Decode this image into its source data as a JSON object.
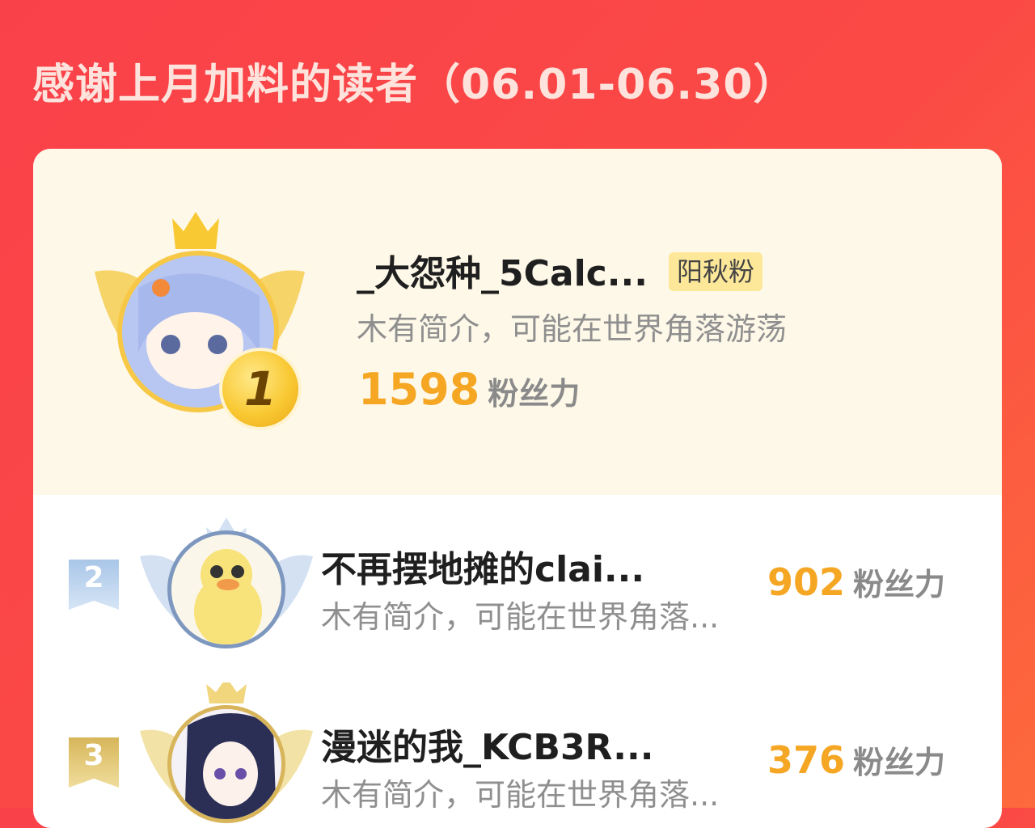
{
  "header": {
    "title": "感谢上月加料的读者（06.01-06.30）"
  },
  "top_reader": {
    "rank": "1",
    "name": "_大怨种_5Calc...",
    "badge": "阳秋粉",
    "bio": "木有简介，可能在世界角落游荡",
    "score": "1598",
    "score_unit": "粉丝力"
  },
  "readers": [
    {
      "rank": "2",
      "name": "不再摆地摊的clai...",
      "bio": "木有简介，可能在世界角落...",
      "score": "902",
      "score_unit": "粉丝力"
    },
    {
      "rank": "3",
      "name": "漫迷的我_KCB3R...",
      "bio": "木有简介，可能在世界角落...",
      "score": "376",
      "score_unit": "粉丝力"
    }
  ],
  "colors": {
    "background": "#f9414a",
    "gold": "#f5a623",
    "badge": "#fde89a",
    "silver": "#a9c6e8",
    "bronze": "#d7b65a"
  }
}
